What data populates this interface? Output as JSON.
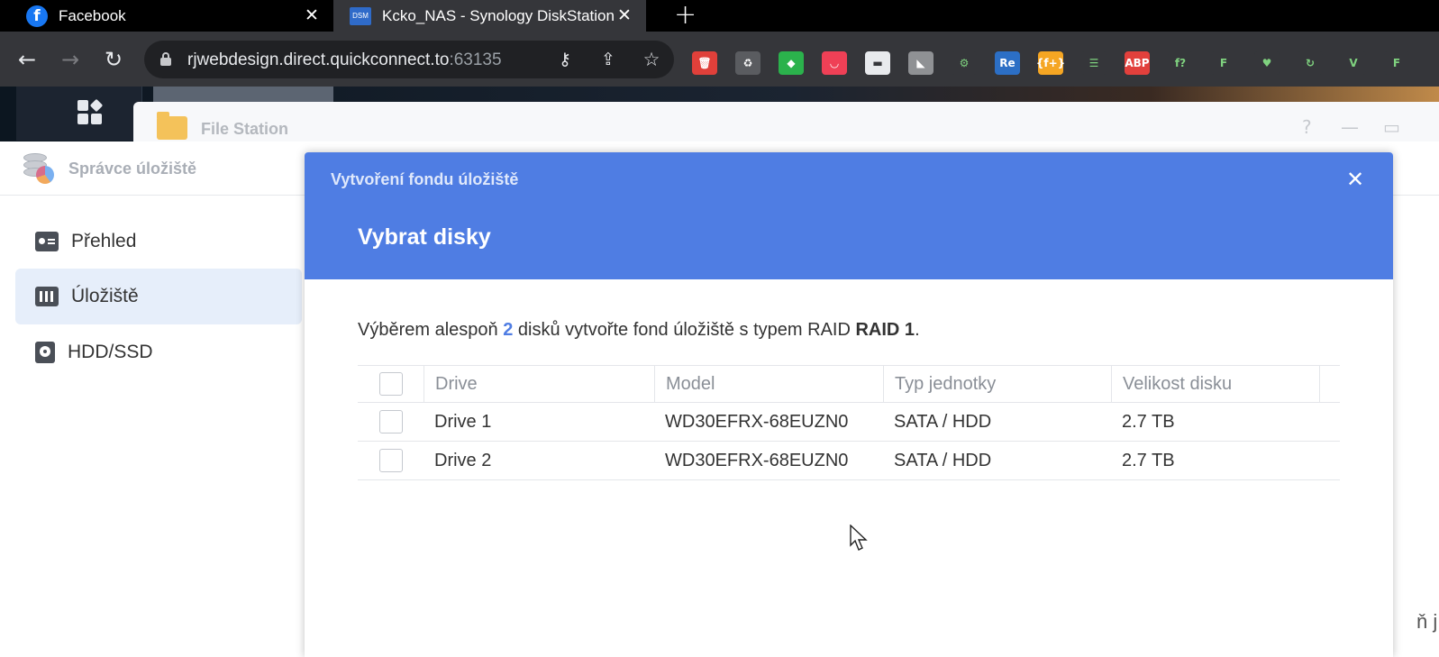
{
  "browser": {
    "tabs": [
      {
        "title": "Facebook",
        "icon": "facebook-icon"
      },
      {
        "title": "Kcko_NAS - Synology DiskStation",
        "icon": "dsm-icon",
        "icon_text": "DSM"
      }
    ],
    "close_glyph": "✕",
    "new_tab_glyph": "+",
    "url_host": "rjwebdesign.direct.quickconnect.to",
    "url_port": ":63135",
    "extensions": [
      {
        "name": "trash-extension-icon",
        "color": "#e0403a",
        "text": "🗑"
      },
      {
        "name": "recycle-extension-icon",
        "color": "#5a5c60",
        "text": "♻"
      },
      {
        "name": "feedly-extension-icon",
        "color": "#2bb24c",
        "text": "◆"
      },
      {
        "name": "pocket-extension-icon",
        "color": "#ef4056",
        "text": "◡"
      },
      {
        "name": "mask-extension-icon",
        "color": "#e8eaed",
        "text": "▬"
      },
      {
        "name": "tab-extension-icon",
        "color": "#8f9194",
        "text": "◣"
      },
      {
        "name": "gear-extension-icon",
        "color": "#35363a",
        "text": "⚙"
      },
      {
        "name": "re-extension-icon",
        "color": "#2c6fc5",
        "text": "Re"
      },
      {
        "name": "function-extension-icon",
        "color": "#f5a623",
        "text": "{f+}"
      },
      {
        "name": "list-extension-icon",
        "color": "#35363a",
        "text": "☰"
      },
      {
        "name": "abp-extension-icon",
        "color": "#e2403c",
        "text": "ABP"
      },
      {
        "name": "fx-extension-icon",
        "color": "#35363a",
        "text": "f?"
      },
      {
        "name": "f-color-extension-icon",
        "color": "#35363a",
        "text": "F"
      },
      {
        "name": "heart-extension-icon",
        "color": "#35363a",
        "text": "♥"
      },
      {
        "name": "refresh-extension-icon",
        "color": "#35363a",
        "text": "↻"
      },
      {
        "name": "v-extension-icon",
        "color": "#35363a",
        "text": "V"
      },
      {
        "name": "f-green-extension-icon",
        "color": "#35363a",
        "text": "F"
      }
    ]
  },
  "file_station": {
    "title": "File Station",
    "help_glyph": "?",
    "minimize_glyph": "—",
    "maximize_glyph": "▭"
  },
  "storage_manager": {
    "title": "Správce úložiště",
    "sidebar": [
      {
        "label": "Přehled",
        "icon": "overview-icon",
        "active": false
      },
      {
        "label": "Úložiště",
        "icon": "storage-icon",
        "active": true
      },
      {
        "label": "HDD/SSD",
        "icon": "hdd-icon",
        "active": false
      }
    ],
    "cut_off_text": "ň j"
  },
  "modal": {
    "wizard_title": "Vytvoření fondu úložiště",
    "close_glyph": "✕",
    "step_title": "Vybrat disky",
    "description": {
      "prefix": "Výběrem alespoň ",
      "min_disks": "2",
      "middle": " disků vytvořte fond úložiště s typem RAID ",
      "raid": "RAID 1",
      "suffix": "."
    },
    "table": {
      "columns": [
        "Drive",
        "Model",
        "Typ jednotky",
        "Velikost disku"
      ],
      "rows": [
        {
          "drive": "Drive 1",
          "model": "WD30EFRX-68EUZN0",
          "type": "SATA / HDD",
          "size": "2.7 TB"
        },
        {
          "drive": "Drive 2",
          "model": "WD30EFRX-68EUZN0",
          "type": "SATA / HDD",
          "size": "2.7 TB"
        }
      ]
    }
  },
  "colors": {
    "accent": "#4f7de3",
    "sidebar_active": "#e6eefa",
    "browser_toolbar": "#35363a"
  }
}
